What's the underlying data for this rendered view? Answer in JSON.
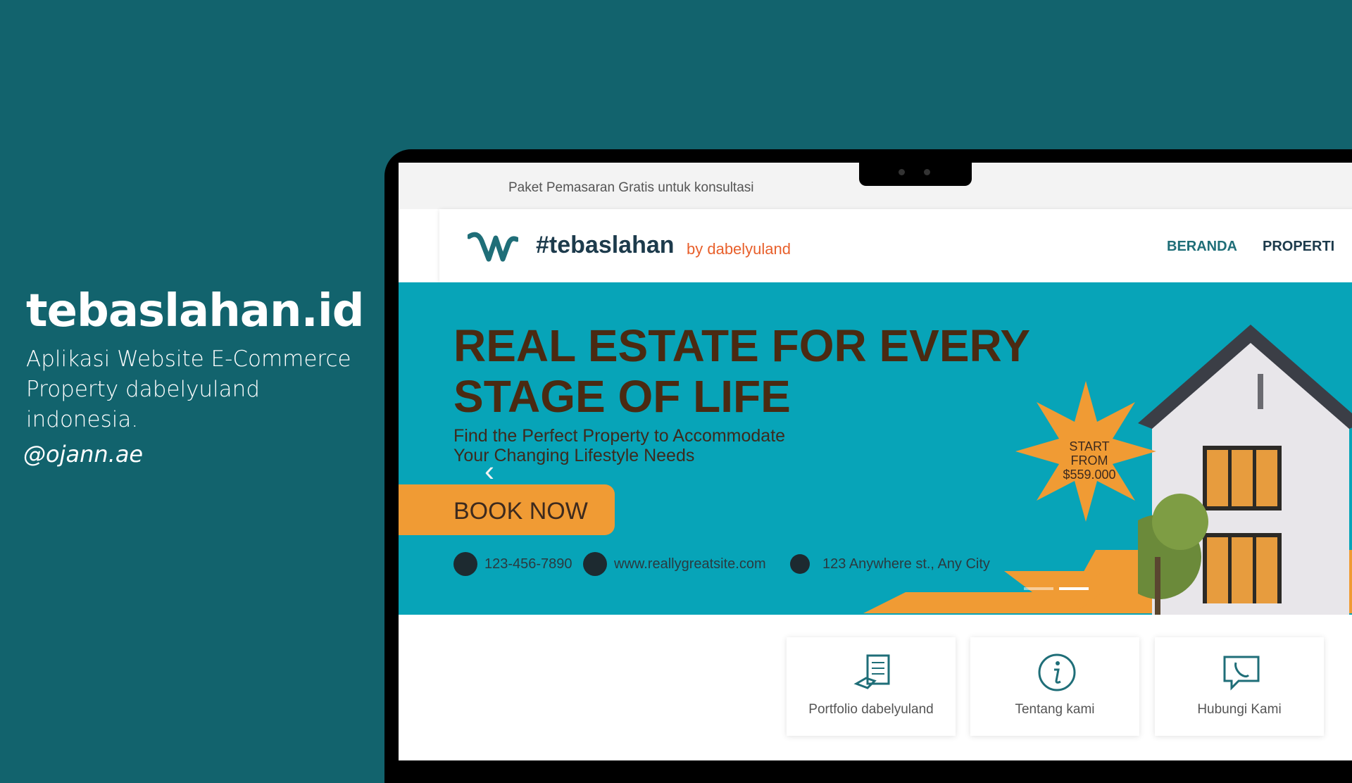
{
  "left_panel": {
    "title": "tebaslahan.id",
    "subtitle_line1": "Aplikasi Website E-Commerce",
    "subtitle_line2": "Property dabelyuland",
    "subtitle_line3": "indonesia.",
    "handle": "@ojann.ae"
  },
  "site": {
    "topbar_text": "Paket Pemasaran Gratis untuk konsultasi",
    "brand": "#tebaslahan",
    "brand_by": "by dabelyuland",
    "nav": [
      "BERANDA",
      "PROPERTI"
    ]
  },
  "hero": {
    "headline_line1": "REAL ESTATE FOR EVERY",
    "headline_line2": "STAGE OF LIFE",
    "sub_line1": "Find the Perfect Property to Accommodate",
    "sub_line2": "Your Changing Lifestyle Needs",
    "cta": "BOOK NOW",
    "start_line1": "START",
    "start_line2": "FROM",
    "start_price": "$559.000",
    "phone": "123-456-7890",
    "website": "www.reallygreatsite.com",
    "address": "123 Anywhere st., Any City"
  },
  "cards": [
    "Portfolio dabelyuland",
    "Tentang kami",
    "Hubungi Kami"
  ],
  "colors": {
    "background": "#12636d",
    "hero": "#07a4b8",
    "accent_orange": "#f09b34",
    "brand_dark": "#1d3b4c",
    "brand_by": "#e8602c"
  }
}
